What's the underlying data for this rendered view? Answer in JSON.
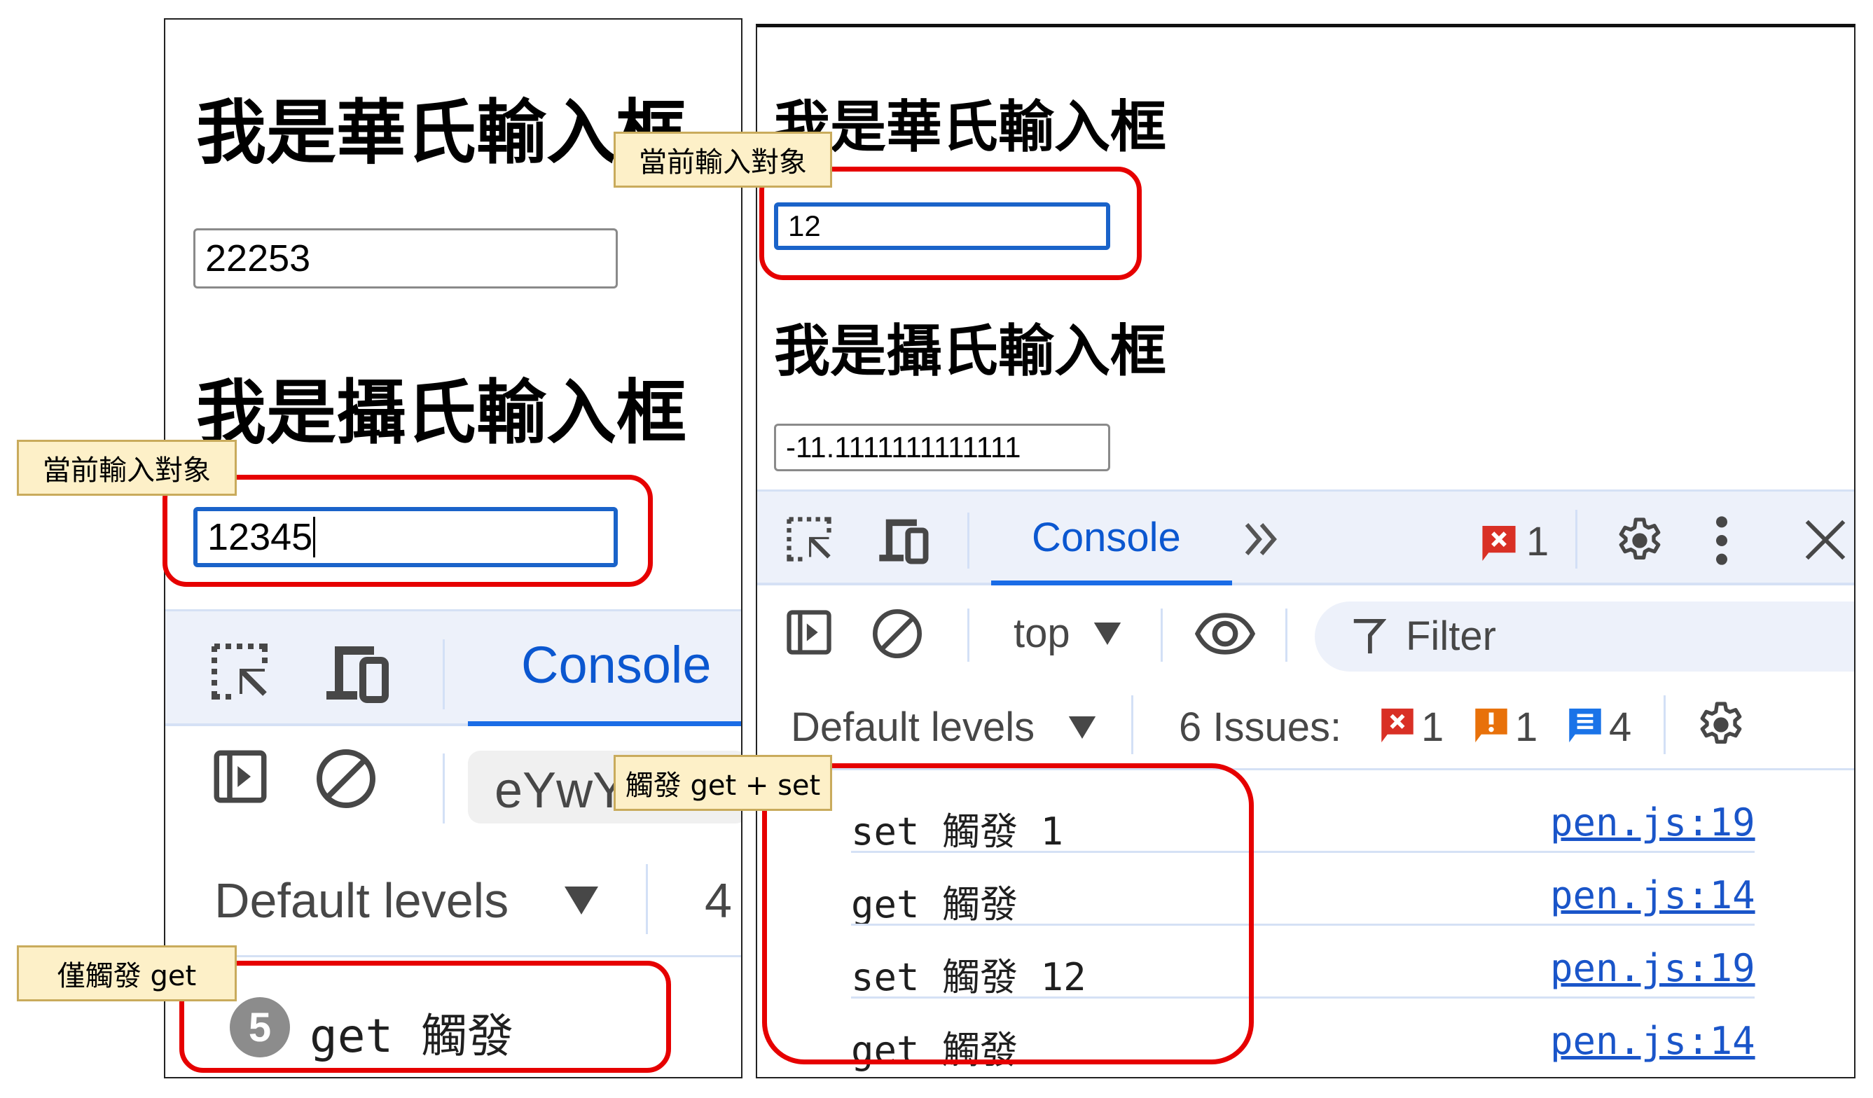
{
  "left_panel": {
    "heading_fahrenheit": "我是華氏輸入框",
    "fahrenheit_value": "22253",
    "heading_celsius": "我是攝氏輸入框",
    "celsius_value": "12345",
    "devtools": {
      "active_tab": "Console",
      "context_selector_value": "eYwY",
      "levels_label": "Default levels",
      "issues_count_partial": "4",
      "log": [
        {
          "repeat_count": "5",
          "message": "get 觸發"
        }
      ]
    }
  },
  "right_panel": {
    "heading_fahrenheit": "我是華氏輸入框",
    "fahrenheit_value": "12",
    "heading_celsius": "我是攝氏輸入框",
    "celsius_value": "-11.1111111111111",
    "devtools": {
      "active_tab": "Console",
      "more_tabs_icon": "chevron-double-right",
      "error_badge_count": "1",
      "context_selector_value": "top",
      "filter_placeholder": "Filter",
      "levels_label": "Default levels",
      "issues_label": "6 Issues:",
      "issues": [
        {
          "type": "error",
          "count": "1",
          "color": "#d93025"
        },
        {
          "type": "warning",
          "count": "1",
          "color": "#e8710a"
        },
        {
          "type": "info",
          "count": "4",
          "color": "#1a73e8"
        }
      ],
      "log": [
        {
          "message": "set 觸發 1",
          "source": "pen.js:19"
        },
        {
          "message": "get 觸發",
          "source": "pen.js:14"
        },
        {
          "message": "set 觸發 12",
          "source": "pen.js:19"
        },
        {
          "message": "get 觸發",
          "source": "pen.js:14"
        }
      ]
    }
  },
  "annotations": {
    "current_input_left": "當前輸入對象",
    "current_input_right": "當前輸入對象",
    "get_only": "僅觸發 get",
    "get_and_set": "觸發 get + set"
  },
  "colors": {
    "highlight": "#e60000",
    "focus": "#1a63c9",
    "accent": "#0b57d0",
    "callout_bg": "#fdf0c8"
  }
}
